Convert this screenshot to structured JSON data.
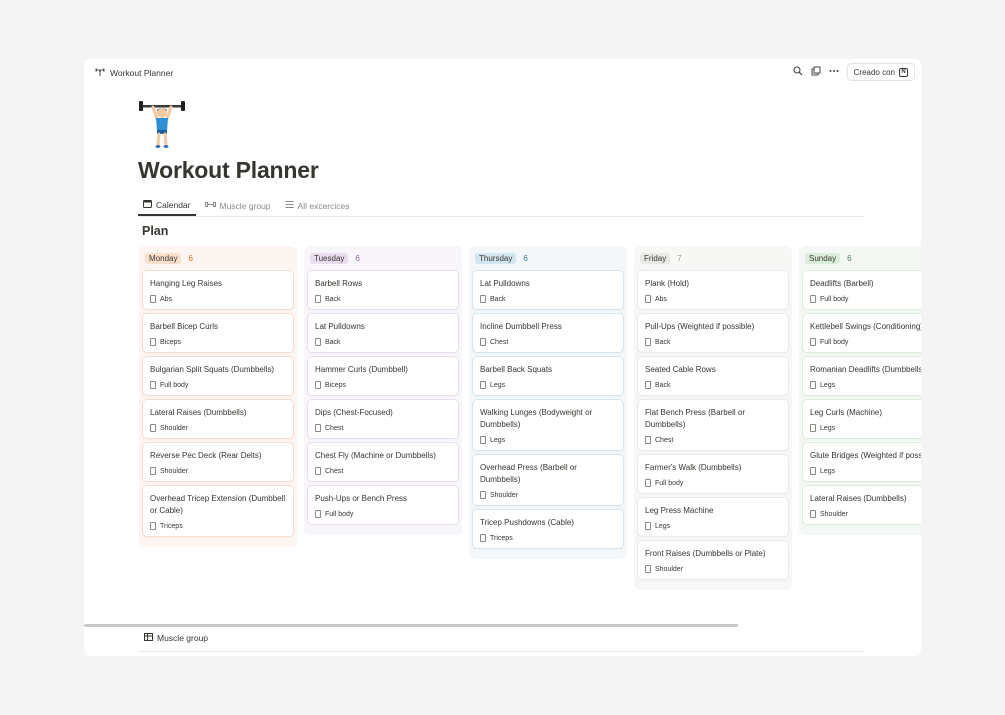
{
  "breadcrumb": {
    "title": "Workout Planner",
    "icon": "weightlifter-icon"
  },
  "topbar": {
    "created_with": "Creado con"
  },
  "page": {
    "title": "Workout Planner"
  },
  "tabs": [
    {
      "label": "Calendar",
      "icon": "calendar-icon",
      "active": true
    },
    {
      "label": "Muscle group",
      "icon": "dumbbell-icon",
      "active": false
    },
    {
      "label": "All excercices",
      "icon": "list-icon",
      "active": false
    }
  ],
  "section": {
    "title": "Plan"
  },
  "columns": [
    {
      "name": "Monday",
      "count": "6",
      "colors": {
        "bg": "#fdf5f1",
        "pill": "#fbdfcb",
        "count": "#d9730d",
        "border": "#f6dccb"
      },
      "cards": [
        {
          "title": "Hanging Leg Raises",
          "tag": "Abs"
        },
        {
          "title": "Barbell Bicep Curls",
          "tag": "Biceps"
        },
        {
          "title": "Bulgarian Split Squats (Dumbbells)",
          "tag": "Full body"
        },
        {
          "title": "Lateral Raises (Dumbbells)",
          "tag": "Shoulder"
        },
        {
          "title": "Reverse Pec Deck (Rear Delts)",
          "tag": "Shoulder"
        },
        {
          "title": "Overhead Tricep Extension (Dumbbell or Cable)",
          "tag": "Triceps"
        }
      ]
    },
    {
      "name": "Tuesday",
      "count": "6",
      "colors": {
        "bg": "#f8f5fb",
        "pill": "#e8deee",
        "count": "#9065b0",
        "border": "#e8deee"
      },
      "cards": [
        {
          "title": "Barbell Rows",
          "tag": "Back"
        },
        {
          "title": "Lat Pulldowns",
          "tag": "Back"
        },
        {
          "title": "Hammer Curls (Dumbbell)",
          "tag": "Biceps"
        },
        {
          "title": "Dips (Chest-Focused)",
          "tag": "Chest"
        },
        {
          "title": "Chest Fly (Machine or Dumbbells)",
          "tag": "Chest"
        },
        {
          "title": "Push-Ups or Bench Press",
          "tag": "Full body"
        }
      ]
    },
    {
      "name": "Thursday",
      "count": "6",
      "colors": {
        "bg": "#f3f7fa",
        "pill": "#d3e5ef",
        "count": "#337ea9",
        "border": "#d3e5ef"
      },
      "cards": [
        {
          "title": "Lat Pulldowns",
          "tag": "Back"
        },
        {
          "title": "Incline Dumbbell Press",
          "tag": "Chest"
        },
        {
          "title": "Barbell Back Squats",
          "tag": "Legs"
        },
        {
          "title": "Walking Lunges (Bodyweight or Dumbbells)",
          "tag": "Legs"
        },
        {
          "title": "Overhead Press (Barbell or Dumbbells)",
          "tag": "Shoulder"
        },
        {
          "title": "Tricep Pushdowns (Cable)",
          "tag": "Triceps"
        }
      ]
    },
    {
      "name": "Friday",
      "count": "7",
      "colors": {
        "bg": "#f7f7f5",
        "pill": "#e9e9e7",
        "count": "#9b9a97",
        "border": "#e9e9e7"
      },
      "cards": [
        {
          "title": "Plank (Hold)",
          "tag": "Abs"
        },
        {
          "title": "Pull-Ups (Weighted if possible)",
          "tag": "Back"
        },
        {
          "title": "Seated Cable Rows",
          "tag": "Back"
        },
        {
          "title": "Flat Bench Press (Barbell or Dumbbells)",
          "tag": "Chest"
        },
        {
          "title": "Farmer's Walk (Dumbbells)",
          "tag": "Full body"
        },
        {
          "title": "Leg Press Machine",
          "tag": "Legs"
        },
        {
          "title": "Front Raises (Dumbbells or Plate)",
          "tag": "Shoulder"
        }
      ]
    },
    {
      "name": "Sunday",
      "count": "6",
      "colors": {
        "bg": "#f4f8f5",
        "pill": "#dbeddb",
        "count": "#448361",
        "border": "#dbeddb"
      },
      "cards": [
        {
          "title": "Deadlifts (Barbell)",
          "tag": "Full body"
        },
        {
          "title": "Kettlebell Swings (Conditioning)",
          "tag": "Full body"
        },
        {
          "title": "Romanian Deadlifts (Dumbbells or Barbell)",
          "tag": "Legs"
        },
        {
          "title": "Leg Curls (Machine)",
          "tag": "Legs"
        },
        {
          "title": "Glute Bridges (Weighted if possible)",
          "tag": "Legs"
        },
        {
          "title": "Lateral Raises (Dumbbells)",
          "tag": "Shoulder"
        }
      ]
    }
  ],
  "footer": {
    "label": "Muscle group",
    "icon": "table-icon"
  }
}
